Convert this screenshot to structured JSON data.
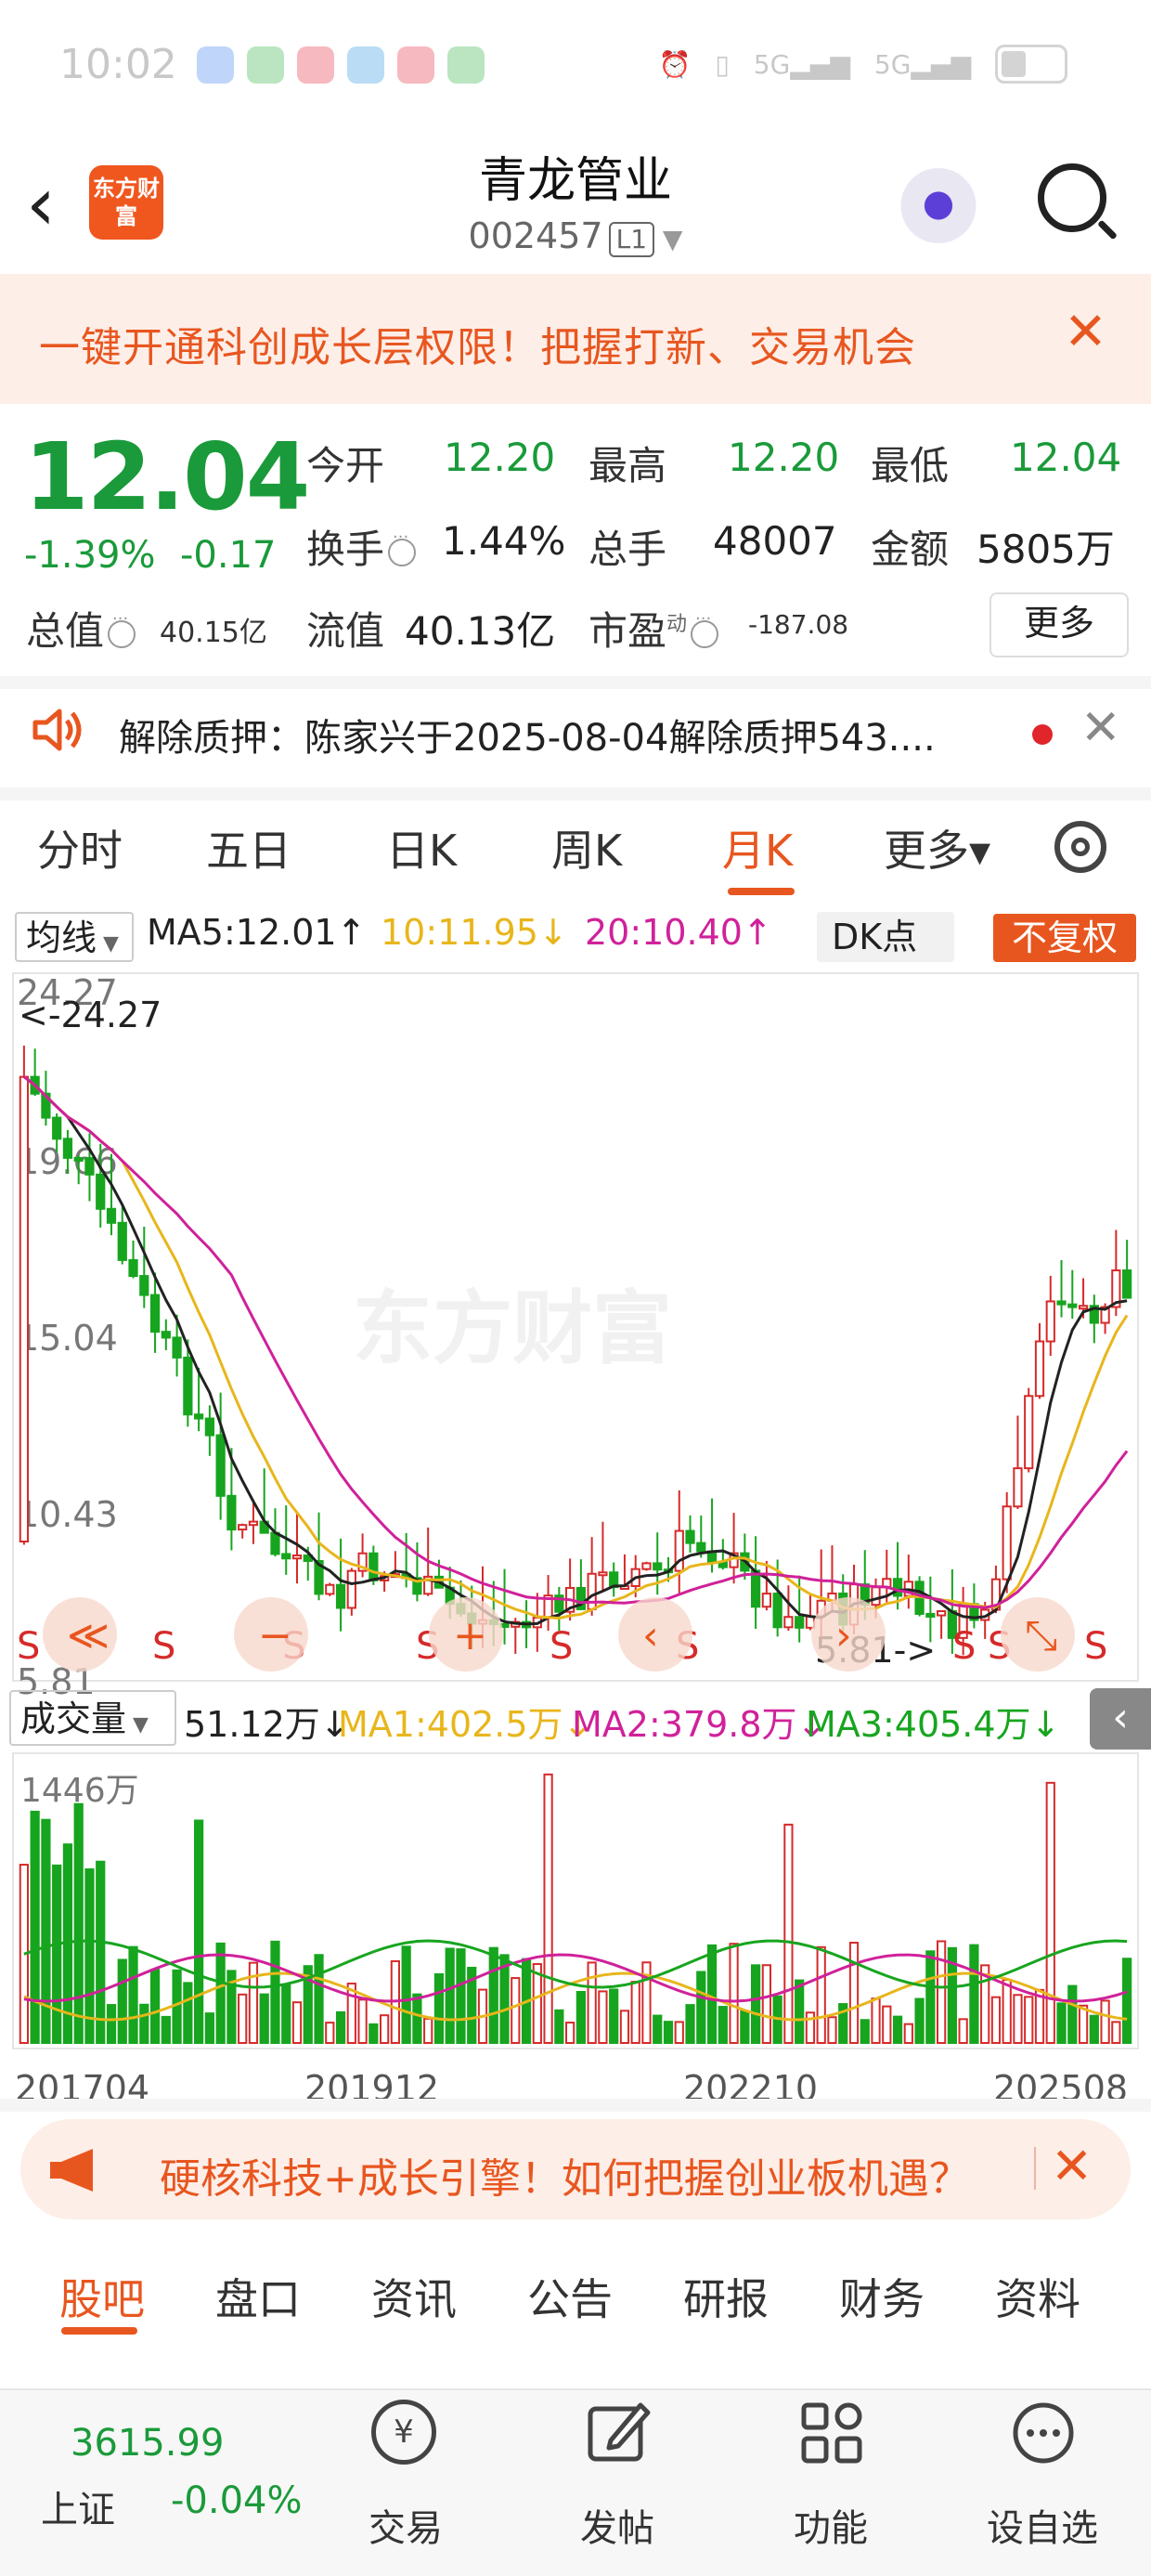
{
  "status_bar": {
    "time": "10:02"
  },
  "header": {
    "back_label": "‹",
    "logo_text": "东方财富",
    "stock_name": "青龙管业",
    "stock_code": "002457",
    "level": "L1"
  },
  "promo": {
    "text": "一键开通科创成长层权限！把握打新、交易机会",
    "close": "✕"
  },
  "quote": {
    "price": "12.04",
    "change_pct": "-1.39%",
    "change": "-0.17",
    "open_label": "今开",
    "open": "12.20",
    "high_label": "最高",
    "high": "12.20",
    "low_label": "最低",
    "low": "12.04",
    "turnover_label": "换手",
    "turnover": "1.44%",
    "volume_label": "总手",
    "volume": "48007",
    "amount_label": "金额",
    "amount": "5805万",
    "mcap_label": "总值",
    "mcap": "40.15亿",
    "float_label": "流值",
    "float": "40.13亿",
    "pe_label": "市盈",
    "pe_sup": "动",
    "pe": "-187.08",
    "more": "更多"
  },
  "notice": {
    "text": "解除质押：陈家兴于2025-08-04解除质押543....",
    "close": "✕"
  },
  "chart_tabs": [
    {
      "label": "分时"
    },
    {
      "label": "五日"
    },
    {
      "label": "日K"
    },
    {
      "label": "周K"
    },
    {
      "label": "月K"
    },
    {
      "label": "更多▾"
    }
  ],
  "indicators": {
    "ma_chip": "均线",
    "ma5": "MA5:12.01↑",
    "ma10": "10:11.95↓",
    "ma20": "20:10.40↑",
    "dk": "DK点",
    "adjust": "不复权",
    "colors": {
      "ma5": "#222222",
      "ma10": "#e8b61c",
      "ma20": "#d0219a",
      "up": "#d62a2a",
      "down": "#17a51f"
    }
  },
  "kline_labels": {
    "y_ticks": [
      "24.27",
      "19.66",
      "15.04",
      "10.43",
      "5.81"
    ],
    "max_marker": "<-24.27",
    "min_marker": "5.81->",
    "watermark": "东方财富",
    "signal": "S"
  },
  "volume": {
    "chip": "成交量",
    "value": "51.12万↓",
    "ma1": "MA1:402.5万↓",
    "ma2": "MA2:379.8万↓",
    "ma3": "MA3:405.4万↓",
    "y_max": "1446万",
    "x_ticks": [
      "201704",
      "201912",
      "202210",
      "202508"
    ],
    "collapse": "‹"
  },
  "ad": {
    "text": "硬核科技+成长引擎！如何把握创业板机遇？",
    "close": "✕"
  },
  "bottom_tabs": [
    {
      "label": "股吧"
    },
    {
      "label": "盘口"
    },
    {
      "label": "资讯"
    },
    {
      "label": "公告"
    },
    {
      "label": "研报"
    },
    {
      "label": "财务"
    },
    {
      "label": "资料"
    }
  ],
  "footer": {
    "index_value": "3615.99",
    "index_name": "上证",
    "index_change": "-0.04%",
    "items": [
      {
        "label": "交易"
      },
      {
        "label": "发帖"
      },
      {
        "label": "功能"
      },
      {
        "label": "设自选"
      }
    ]
  }
}
